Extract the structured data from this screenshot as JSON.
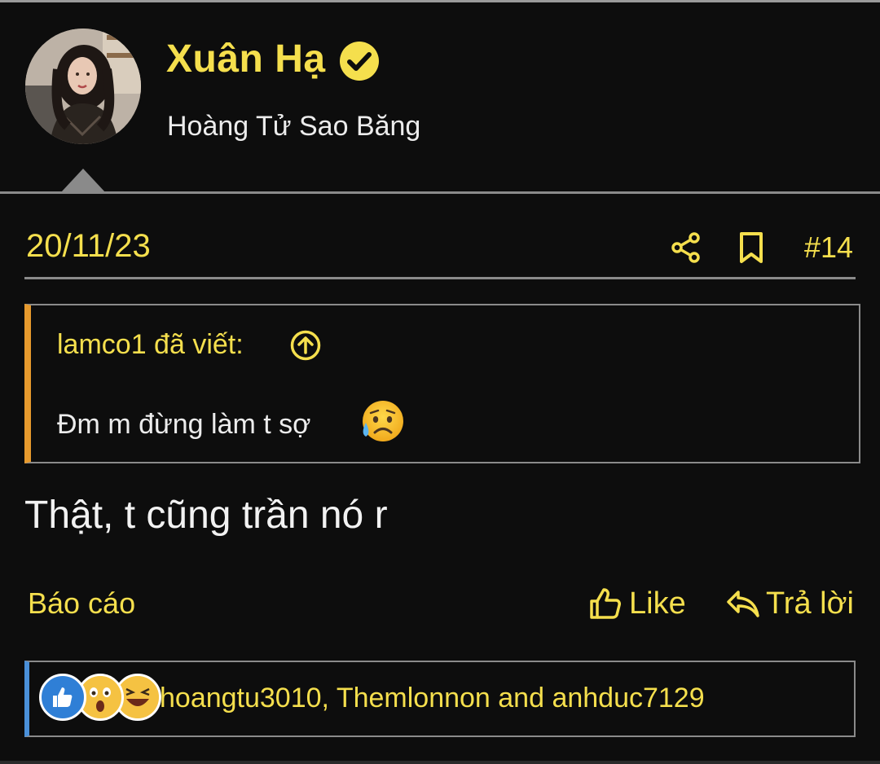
{
  "user": {
    "name": "Xuân Hạ",
    "title": "Hoàng Tử Sao Băng"
  },
  "post": {
    "date": "20/11/23",
    "number": "#14",
    "body": "Thật, t cũng trần nó r"
  },
  "quote": {
    "author_line": "lamco1 đã viết:",
    "text": "Đm m đừng làm t sợ"
  },
  "actions": {
    "report_label": "Báo cáo",
    "like_label": "Like",
    "reply_label": "Trả lời"
  },
  "reactions": {
    "icons": [
      "like-icon",
      "wow-icon",
      "laugh-icon"
    ],
    "users_text": "hoangtu3010, Themlonnon and anhduc7129"
  },
  "colors": {
    "background": "#0d0d0d",
    "accent_yellow": "#f5df4d",
    "text": "#ececec",
    "quote_border_orange": "#e79a2d",
    "reactions_border_blue": "#4a90d9",
    "divider_gray": "#8a8a8a"
  }
}
